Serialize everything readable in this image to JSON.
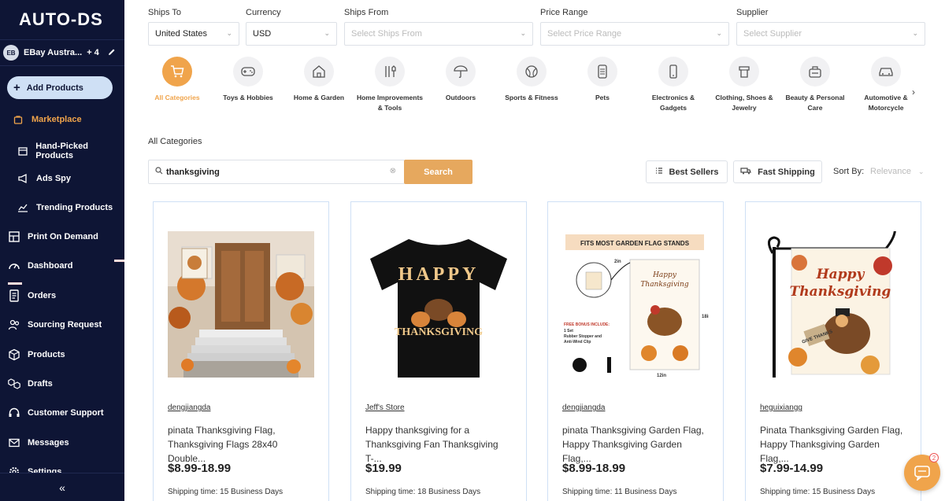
{
  "app": {
    "logo": "AUTO-DS"
  },
  "store": {
    "badge": "EB",
    "name": "EBay Austra...",
    "extra": "+ 4"
  },
  "sidebar": {
    "add_products": "Add Products",
    "items": [
      {
        "label": "Marketplace",
        "icon": "bag-icon"
      },
      {
        "label": "Hand-Picked Products",
        "icon": "box-icon"
      },
      {
        "label": "Ads Spy",
        "icon": "megaphone-icon"
      },
      {
        "label": "Trending Products",
        "icon": "chart-icon"
      },
      {
        "label": "Print On Demand",
        "icon": "print-icon"
      },
      {
        "label": "Dashboard",
        "icon": "gauge-icon"
      },
      {
        "label": "Orders",
        "icon": "document-icon"
      },
      {
        "label": "Sourcing Request",
        "icon": "people-icon"
      },
      {
        "label": "Products",
        "icon": "cube-icon"
      },
      {
        "label": "Drafts",
        "icon": "cubes-icon"
      },
      {
        "label": "Customer Support",
        "icon": "headset-icon"
      },
      {
        "label": "Messages",
        "icon": "mail-icon"
      },
      {
        "label": "Settings",
        "icon": "gear-icon"
      }
    ],
    "collapse": "«"
  },
  "filters": {
    "ships_to": {
      "label": "Ships To",
      "value": "United States"
    },
    "currency": {
      "label": "Currency",
      "value": "USD"
    },
    "ships_from": {
      "label": "Ships From",
      "placeholder": "Select Ships From"
    },
    "price_range": {
      "label": "Price Range",
      "placeholder": "Select Price Range"
    },
    "supplier": {
      "label": "Supplier",
      "placeholder": "Select Supplier"
    }
  },
  "categories": [
    {
      "label": "All Categories",
      "icon": "cart-icon"
    },
    {
      "label": "Toys & Hobbies",
      "icon": "gamepad-icon"
    },
    {
      "label": "Home & Garden",
      "icon": "house-icon"
    },
    {
      "label": "Home Improvements & Tools",
      "icon": "tools-icon"
    },
    {
      "label": "Outdoors",
      "icon": "umbrella-icon"
    },
    {
      "label": "Sports & Fitness",
      "icon": "ball-icon"
    },
    {
      "label": "Pets",
      "icon": "pet-food-icon"
    },
    {
      "label": "Electronics & Gadgets",
      "icon": "phone-icon"
    },
    {
      "label": "Clothing, Shoes & Jewelry",
      "icon": "clothing-icon"
    },
    {
      "label": "Beauty & Personal Care",
      "icon": "beauty-icon"
    },
    {
      "label": "Automotive & Motorcycle",
      "icon": "car-icon"
    }
  ],
  "breadcrumb": "All Categories",
  "search": {
    "value": "thanksgiving",
    "button": "Search"
  },
  "toolbar": {
    "best_sellers": "Best Sellers",
    "fast_shipping": "Fast Shipping",
    "sort_label": "Sort By:",
    "sort_value": "Relevance"
  },
  "products": [
    {
      "store": "dengjiangda",
      "title": "pinata Thanksgiving Flag, Thanksgiving Flags 28x40 Double...",
      "price": "$8.99-18.99",
      "shipping": "Shipping time: 15 Business Days"
    },
    {
      "store": "Jeff's Store",
      "title": "Happy thanksgiving for a Thanksgiving Fan Thanksgiving T-...",
      "price": "$19.99",
      "shipping": "Shipping time: 18 Business Days"
    },
    {
      "store": "dengjiangda",
      "title": "pinata Thanksgiving Garden Flag, Happy Thanksgiving Garden Flag,...",
      "price": "$8.99-18.99",
      "shipping": "Shipping time: 11 Business Days"
    },
    {
      "store": "heguixiangg",
      "title": "Pinata Thanksgiving Garden Flag, Happy Thanksgiving Garden Flag,...",
      "price": "$7.99-14.99",
      "shipping": "Shipping time: 15 Business Days"
    }
  ],
  "product_images": {
    "tshirt_text_1": "HAPPY",
    "tshirt_text_2": "THANKSGIVING",
    "flag_banner": "FITS MOST GARDEN FLAG STANDS",
    "flag_text_1": "Happy",
    "flag_text_2": "Thanksgiving",
    "flag_dim_top": "2in",
    "flag_dim_side": "18in",
    "flag_dim_bottom": "12in",
    "flag_bonus_title": "FREE BONUS INCLUDE:",
    "flag_bonus_lines": [
      "1 Set",
      "Rubber Stopper and",
      "Anti-Wind Clip"
    ],
    "flag4_text_1": "Happy",
    "flag4_text_2": "Thanksgiving",
    "flag4_sign": "GIVE THANKS"
  },
  "chat": {
    "count": "2"
  },
  "colors": {
    "sidebar_bg": "#0e1535",
    "accent": "#f0a44b",
    "card_border": "#cfe0f5"
  }
}
